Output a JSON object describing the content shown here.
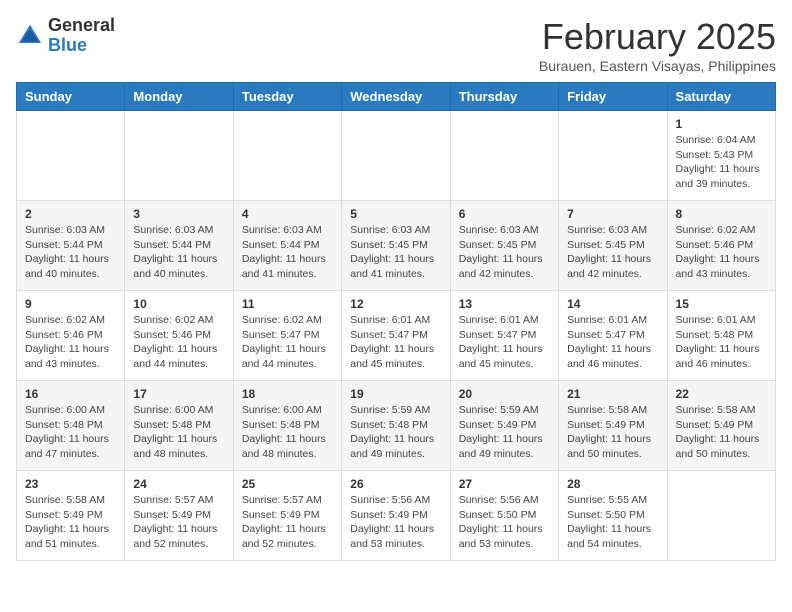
{
  "header": {
    "logo_general": "General",
    "logo_blue": "Blue",
    "month_title": "February 2025",
    "location": "Burauen, Eastern Visayas, Philippines"
  },
  "days_of_week": [
    "Sunday",
    "Monday",
    "Tuesday",
    "Wednesday",
    "Thursday",
    "Friday",
    "Saturday"
  ],
  "weeks": [
    [
      {
        "day": "",
        "info": ""
      },
      {
        "day": "",
        "info": ""
      },
      {
        "day": "",
        "info": ""
      },
      {
        "day": "",
        "info": ""
      },
      {
        "day": "",
        "info": ""
      },
      {
        "day": "",
        "info": ""
      },
      {
        "day": "1",
        "info": "Sunrise: 6:04 AM\nSunset: 5:43 PM\nDaylight: 11 hours and 39 minutes."
      }
    ],
    [
      {
        "day": "2",
        "info": "Sunrise: 6:03 AM\nSunset: 5:44 PM\nDaylight: 11 hours and 40 minutes."
      },
      {
        "day": "3",
        "info": "Sunrise: 6:03 AM\nSunset: 5:44 PM\nDaylight: 11 hours and 40 minutes."
      },
      {
        "day": "4",
        "info": "Sunrise: 6:03 AM\nSunset: 5:44 PM\nDaylight: 11 hours and 41 minutes."
      },
      {
        "day": "5",
        "info": "Sunrise: 6:03 AM\nSunset: 5:45 PM\nDaylight: 11 hours and 41 minutes."
      },
      {
        "day": "6",
        "info": "Sunrise: 6:03 AM\nSunset: 5:45 PM\nDaylight: 11 hours and 42 minutes."
      },
      {
        "day": "7",
        "info": "Sunrise: 6:03 AM\nSunset: 5:45 PM\nDaylight: 11 hours and 42 minutes."
      },
      {
        "day": "8",
        "info": "Sunrise: 6:02 AM\nSunset: 5:46 PM\nDaylight: 11 hours and 43 minutes."
      }
    ],
    [
      {
        "day": "9",
        "info": "Sunrise: 6:02 AM\nSunset: 5:46 PM\nDaylight: 11 hours and 43 minutes."
      },
      {
        "day": "10",
        "info": "Sunrise: 6:02 AM\nSunset: 5:46 PM\nDaylight: 11 hours and 44 minutes."
      },
      {
        "day": "11",
        "info": "Sunrise: 6:02 AM\nSunset: 5:47 PM\nDaylight: 11 hours and 44 minutes."
      },
      {
        "day": "12",
        "info": "Sunrise: 6:01 AM\nSunset: 5:47 PM\nDaylight: 11 hours and 45 minutes."
      },
      {
        "day": "13",
        "info": "Sunrise: 6:01 AM\nSunset: 5:47 PM\nDaylight: 11 hours and 45 minutes."
      },
      {
        "day": "14",
        "info": "Sunrise: 6:01 AM\nSunset: 5:47 PM\nDaylight: 11 hours and 46 minutes."
      },
      {
        "day": "15",
        "info": "Sunrise: 6:01 AM\nSunset: 5:48 PM\nDaylight: 11 hours and 46 minutes."
      }
    ],
    [
      {
        "day": "16",
        "info": "Sunrise: 6:00 AM\nSunset: 5:48 PM\nDaylight: 11 hours and 47 minutes."
      },
      {
        "day": "17",
        "info": "Sunrise: 6:00 AM\nSunset: 5:48 PM\nDaylight: 11 hours and 48 minutes."
      },
      {
        "day": "18",
        "info": "Sunrise: 6:00 AM\nSunset: 5:48 PM\nDaylight: 11 hours and 48 minutes."
      },
      {
        "day": "19",
        "info": "Sunrise: 5:59 AM\nSunset: 5:48 PM\nDaylight: 11 hours and 49 minutes."
      },
      {
        "day": "20",
        "info": "Sunrise: 5:59 AM\nSunset: 5:49 PM\nDaylight: 11 hours and 49 minutes."
      },
      {
        "day": "21",
        "info": "Sunrise: 5:58 AM\nSunset: 5:49 PM\nDaylight: 11 hours and 50 minutes."
      },
      {
        "day": "22",
        "info": "Sunrise: 5:58 AM\nSunset: 5:49 PM\nDaylight: 11 hours and 50 minutes."
      }
    ],
    [
      {
        "day": "23",
        "info": "Sunrise: 5:58 AM\nSunset: 5:49 PM\nDaylight: 11 hours and 51 minutes."
      },
      {
        "day": "24",
        "info": "Sunrise: 5:57 AM\nSunset: 5:49 PM\nDaylight: 11 hours and 52 minutes."
      },
      {
        "day": "25",
        "info": "Sunrise: 5:57 AM\nSunset: 5:49 PM\nDaylight: 11 hours and 52 minutes."
      },
      {
        "day": "26",
        "info": "Sunrise: 5:56 AM\nSunset: 5:49 PM\nDaylight: 11 hours and 53 minutes."
      },
      {
        "day": "27",
        "info": "Sunrise: 5:56 AM\nSunset: 5:50 PM\nDaylight: 11 hours and 53 minutes."
      },
      {
        "day": "28",
        "info": "Sunrise: 5:55 AM\nSunset: 5:50 PM\nDaylight: 11 hours and 54 minutes."
      },
      {
        "day": "",
        "info": ""
      }
    ]
  ]
}
